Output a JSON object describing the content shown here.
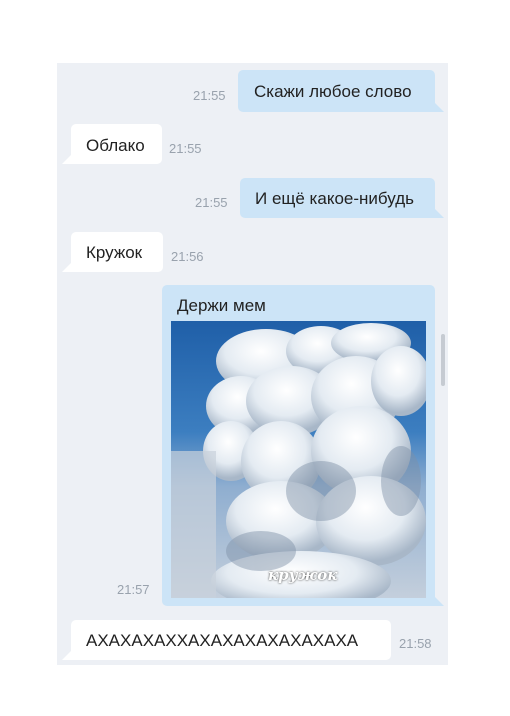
{
  "messages": [
    {
      "direction": "out",
      "text": "Скажи любое слово",
      "time": "21:55"
    },
    {
      "direction": "in",
      "text": "Облако",
      "time": "21:55"
    },
    {
      "direction": "out",
      "text": "И ещё какое-нибудь",
      "time": "21:55"
    },
    {
      "direction": "in",
      "text": "Кружок",
      "time": "21:56"
    },
    {
      "direction": "out",
      "text": "Держи мем",
      "time": "21:57",
      "image_caption": "кружок"
    },
    {
      "direction": "in",
      "text": "АХАХАХАХХАХАХАХАХАХАХАХА",
      "time": "21:58"
    }
  ],
  "colors": {
    "chat_background": "#edf0f5",
    "incoming_bubble": "#ffffff",
    "outgoing_bubble": "#cce4f7",
    "timestamp": "#99a2ad",
    "text": "#222222"
  }
}
